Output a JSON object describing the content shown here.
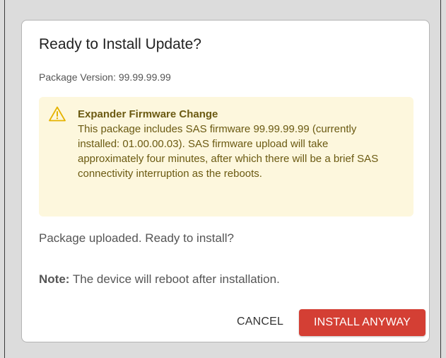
{
  "dialog": {
    "title": "Ready to Install Update?",
    "version_label": "Package Version:",
    "version_value": "99.99.99.99",
    "warning": {
      "icon": "warning-triangle-icon",
      "heading": "Expander Firmware Change",
      "body": "This package includes SAS firmware 99.99.99.99 (currently installed: 01.00.00.03). SAS firmware upload will take approximately four minutes, after which there will be a brief SAS connectivity interruption as the reboots."
    },
    "status_text": "Package uploaded. Ready to install?",
    "note_label": "Note:",
    "note_text": "The device will reboot after installation.",
    "buttons": {
      "cancel_label": "CANCEL",
      "install_label": "INSTALL ANYWAY"
    }
  },
  "colors": {
    "install_button": "#d43f34",
    "warning_background": "#fdf7dd",
    "warning_text": "#6b5a12",
    "warning_icon": "#e5b300"
  }
}
